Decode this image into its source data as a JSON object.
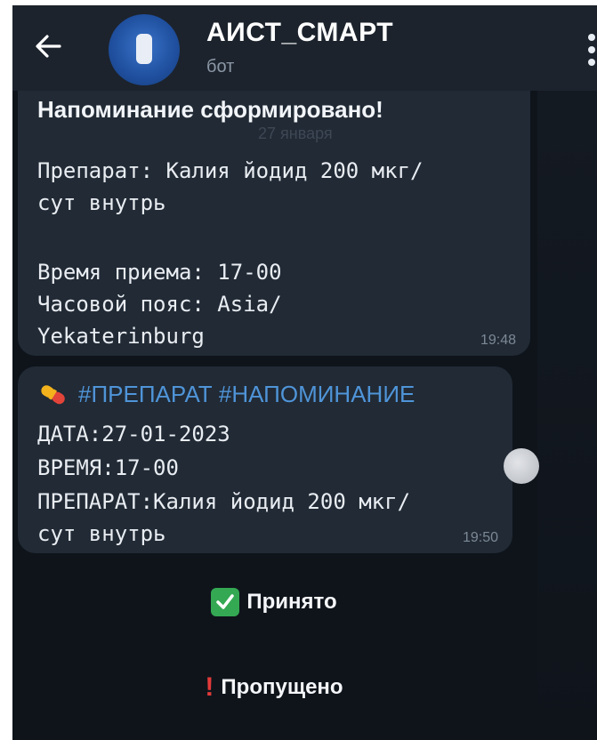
{
  "header": {
    "back_icon": "arrow-left-icon",
    "title": "АИСТ_СМАРТ",
    "subtitle": "бот",
    "menu_icon": "more-vertical-icon"
  },
  "message1": {
    "heading": "Напоминание сформировано!",
    "date_chip": "27 января",
    "lines": [
      "Препарат: Калия йодид 200 мкг/",
      "сут внутрь",
      "Время приема: 17-00",
      "Часовой пояс: Asia/",
      "Yekaterinburg"
    ],
    "time": "19:48"
  },
  "message2": {
    "icon": "pill-icon",
    "tags": "#ПРЕПАРАТ #НАПОМИНАНИЕ",
    "lines": [
      "ДАТА:27-01-2023",
      "ВРЕМЯ:17-00",
      "ПРЕПАРАТ:Калия йодид 200 мкг/",
      "сут внутрь"
    ],
    "time": "19:50"
  },
  "buttons": {
    "accepted": {
      "icon": "check-box-icon",
      "label": "Принято"
    },
    "missed": {
      "icon": "exclamation-icon",
      "label": "Пропущено"
    }
  },
  "colors": {
    "background": "#0f141b",
    "bubble": "#212a35",
    "header": "#1c232d",
    "hashtag": "#4f94d8"
  }
}
